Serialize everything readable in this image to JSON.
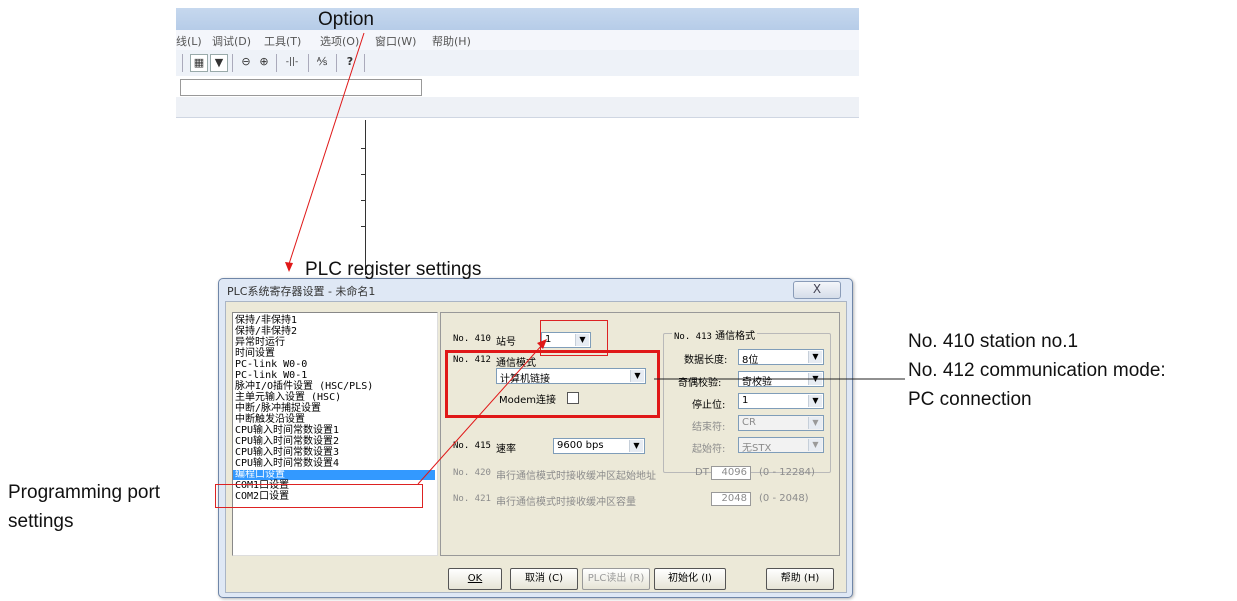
{
  "annotations": {
    "option": "Option",
    "plc_register": "PLC register settings",
    "programming_port_line1": "Programming port",
    "programming_port_line2": "settings",
    "right_line1": "No. 410 station no.1",
    "right_line2": "No. 412 communication mode:",
    "right_line3": "PC connection"
  },
  "app_menu": [
    "线(L)",
    "调试(D)",
    "工具(T)",
    "选项(O)",
    "窗口(W)",
    "帮助(H)"
  ],
  "dialog": {
    "title": "PLC系统寄存器设置 - 未命名1",
    "close": "X",
    "nav_items": [
      "保持/非保持1",
      "保持/非保持2",
      "异常时运行",
      "时间设置",
      "PC-link W0-0",
      "PC-link W0-1",
      "脉冲I/O插件设置 (HSC/PLS)",
      "主单元输入设置 (HSC)",
      "中断/脉冲捕捉设置",
      "中断触发沿设置",
      "CPU输入时间常数设置1",
      "CPU输入时间常数设置2",
      "CPU输入时间常数设置3",
      "CPU输入时间常数设置4",
      "编程口设置",
      "COM1口设置",
      "COM2口设置"
    ],
    "selected_index": 14,
    "no410_label": "No. 410",
    "station_label": "站号",
    "station_value": "1",
    "no412_label": "No. 412",
    "comm_mode_label": "通信模式",
    "comm_mode_value": "计算机链接",
    "modem_label": "Modem连接",
    "no413_label": "No. 413",
    "comm_format_label": "通信格式",
    "data_length_label": "数据长度:",
    "data_length_value": "8位",
    "parity_label": "奇偶校验:",
    "parity_value": "奇校验",
    "stop_bit_label": "停止位:",
    "stop_bit_value": "1",
    "terminator_label": "结束符:",
    "terminator_value": "CR",
    "start_char_label": "起始符:",
    "start_char_value": "无STX",
    "no415_label": "No. 415",
    "baud_label": "速率",
    "baud_value": "9600 bps",
    "no420_label": "No. 420",
    "no420_text": "串行通信模式时接收缓冲区起始地址",
    "dt_label": "DT",
    "no420_value": "4096",
    "no420_range": "(0 - 12284)",
    "no421_label": "No. 421",
    "no421_text": "串行通信模式时接收缓冲区容量",
    "no421_value": "2048",
    "no421_range": "(0 - 2048)",
    "buttons": {
      "ok": "OK",
      "cancel": "取消 (C)",
      "read_plc": "PLC读出 (R)",
      "init": "初始化 (I)",
      "help": "帮助 (H)"
    }
  }
}
